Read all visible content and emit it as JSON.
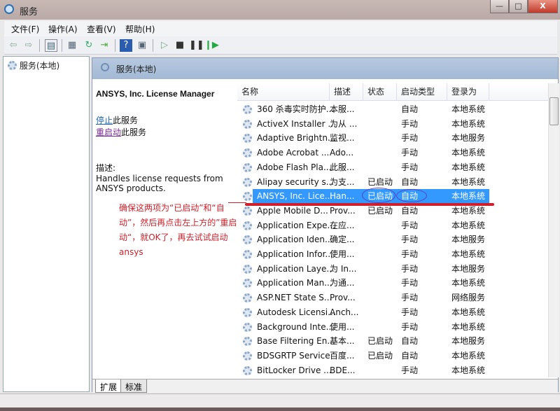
{
  "window": {
    "title": "服务",
    "minimize": "—",
    "maximize": "□",
    "close": "X"
  },
  "menu": [
    "文件(F)",
    "操作(A)",
    "查看(V)",
    "帮助(H)"
  ],
  "toolbar": {
    "icons": [
      "back-icon",
      "forward-icon",
      "console-tree-icon",
      "properties-icon",
      "refresh-icon",
      "export-icon",
      "help-icon",
      "view-icon",
      "start-icon",
      "stop-icon",
      "pause-icon",
      "restart-icon"
    ]
  },
  "tree": {
    "item": "服务(本地)"
  },
  "pane": {
    "title": "服务(本地)"
  },
  "details": {
    "service_name": "ANSYS, Inc. License Manager",
    "stop_link": "停止",
    "stop_suffix": "此服务",
    "restart_link": "重启动",
    "restart_suffix": "此服务",
    "desc_label": "描述:",
    "desc_text": "Handles license requests from ANSYS products."
  },
  "annotation": {
    "text": "确保这两项为“已启动”和“自动”，然后再点击左上方的”重启动“，就OK了，再去试试启动ansys",
    "color": "#d0202a"
  },
  "columns": [
    "名称",
    "描述",
    "状态",
    "启动类型",
    "登录为"
  ],
  "rows": [
    [
      "360 杀毒实时防护...",
      "本服...",
      "",
      "自动",
      "本地系统"
    ],
    [
      "ActiveX Installer ...",
      "为从 ...",
      "",
      "手动",
      "本地系统"
    ],
    [
      "Adaptive Brightn...",
      "监视...",
      "",
      "手动",
      "本地服务"
    ],
    [
      "Adobe Acrobat ...",
      "Ado...",
      "",
      "手动",
      "本地系统"
    ],
    [
      "Adobe Flash Pla...",
      "此服...",
      "",
      "手动",
      "本地系统"
    ],
    [
      "Alipay security s...",
      "为支...",
      "已启动",
      "自动",
      "本地系统"
    ],
    [
      "ANSYS, Inc. Lice...",
      "Han...",
      "已启动",
      "自动",
      "本地系统"
    ],
    [
      "Apple Mobile D...",
      "Prov...",
      "已启动",
      "自动",
      "本地系统"
    ],
    [
      "Application Expe...",
      "在应...",
      "",
      "手动",
      "本地系统"
    ],
    [
      "Application Iden...",
      "确定...",
      "",
      "手动",
      "本地服务"
    ],
    [
      "Application Infor...",
      "使用...",
      "",
      "手动",
      "本地系统"
    ],
    [
      "Application Laye...",
      "为 In...",
      "",
      "手动",
      "本地服务"
    ],
    [
      "Application Man...",
      "为通...",
      "",
      "手动",
      "本地系统"
    ],
    [
      "ASP.NET State S...",
      "Prov...",
      "",
      "手动",
      "网络服务"
    ],
    [
      "Autodesk Licensi...",
      "Anch...",
      "",
      "手动",
      "本地系统"
    ],
    [
      "Background Inte...",
      "使用...",
      "",
      "手动",
      "本地系统"
    ],
    [
      "Base Filtering En...",
      "基本...",
      "已启动",
      "自动",
      "本地服务"
    ],
    [
      "BDSGRTP Service",
      "百度...",
      "已启动",
      "自动",
      "本地系统"
    ],
    [
      "BitLocker Drive ...",
      "BDE...",
      "",
      "手动",
      "本地系统"
    ]
  ],
  "selected_index": 6,
  "tabs": [
    "扩展",
    "标准"
  ],
  "colors": {
    "selection": "#3399ff",
    "band": "#a2b8d4"
  }
}
